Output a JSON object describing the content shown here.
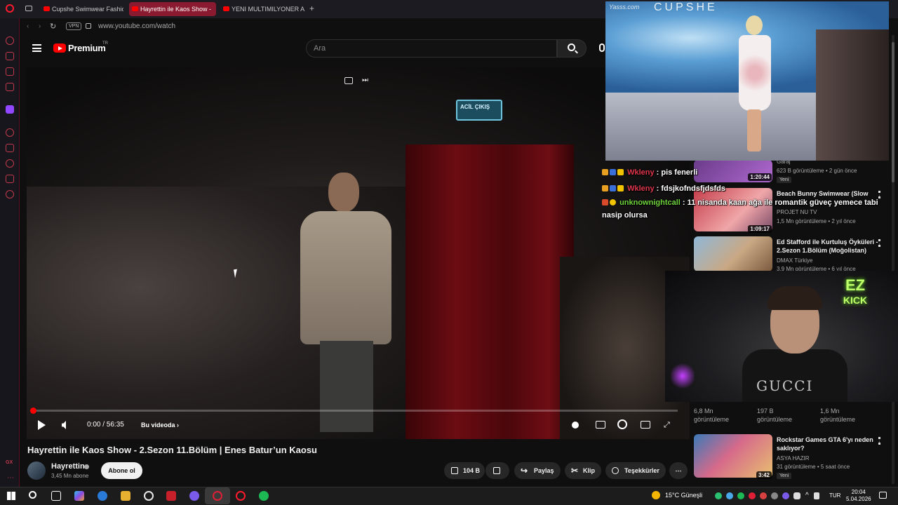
{
  "browser": {
    "tabs": [
      {
        "label": "Cupshe Swimwear Fashio"
      },
      {
        "label": "Hayrettin ile Kaos Show -"
      },
      {
        "label": "YENI MULTIMILYONER AR"
      }
    ],
    "url": "www.youtube.com/watch",
    "vpn": "VPN"
  },
  "youtube": {
    "logo_text": "Premium",
    "logo_region": "TR",
    "search_placeholder": "Ara"
  },
  "player": {
    "exit_sign": "ACİL ÇIKIŞ",
    "time": "0:00 / 56:35",
    "chapter": "Bu videoda",
    "progress": 0.0
  },
  "video": {
    "title": "Hayrettin ile Kaos Show - 2.Sezon 11.Bölüm | Enes Batur’un Kaosu",
    "channel": "Hayrettin",
    "subscribers": "3,45 Mn abone",
    "subscribe_label": "Abone ol",
    "likes": "104 B",
    "share_label": "Paylaş",
    "clip_label": "Klip",
    "thanks_label": "Teşekkürler"
  },
  "recommendations": [
    {
      "title": "",
      "channel": "Garaj",
      "meta": "623 B görüntüleme • 2 gün önce",
      "duration": "1:20:44",
      "badge": "Yeni"
    },
    {
      "title": "Beach Bunny Swimwear (Slow",
      "channel": "PROJET NU TV",
      "meta": "1,5 Mn görüntüleme • 2 yıl önce",
      "duration": "1:09:17"
    },
    {
      "title": "Ed Stafford ile Kurtuluş Öyküleri - 2.Sezon 1.Bölüm (Moğolistan)",
      "channel": "DMAX Türkiye",
      "meta": "3,9 Mn görüntüleme • 6 yıl önce",
      "duration": ""
    },
    {
      "title": "Rockstar Games GTA 6'yı neden saklıyor?",
      "channel": "ASYA HAZIR",
      "meta": "31 görüntüleme • 5 saat önce",
      "duration": "3:42",
      "badge": "Yeni"
    }
  ],
  "shorts_stats": [
    {
      "views": "6,8 Mn",
      "label": "görüntüleme"
    },
    {
      "views": "197 B",
      "label": "görüntüleme"
    },
    {
      "views": "1,6 Mn",
      "label": "görüntüleme"
    }
  ],
  "stream_overlay": {
    "pip_watermark": "Yasss.com",
    "pip_brand": "CUPSHE",
    "chat": [
      {
        "user": "Wkleny",
        "message": " : pis fenerli"
      },
      {
        "user": "Wkleny",
        "message": " : fdsjkofndsfjdsfds"
      },
      {
        "user": "unknownightcall",
        "message": " : 11 nisanda kaan ağa ile romantik güveç yemece tabi"
      },
      {
        "user": "",
        "message": "nasip olursa"
      }
    ],
    "cam_shirt": "GUCCI",
    "cam_sign_top": "EZ",
    "cam_sign_bottom": "KICK"
  },
  "taskbar": {
    "weather": "15°C  Güneşli",
    "language": "TUR",
    "time": "20:04",
    "date": "5.04.2026"
  }
}
